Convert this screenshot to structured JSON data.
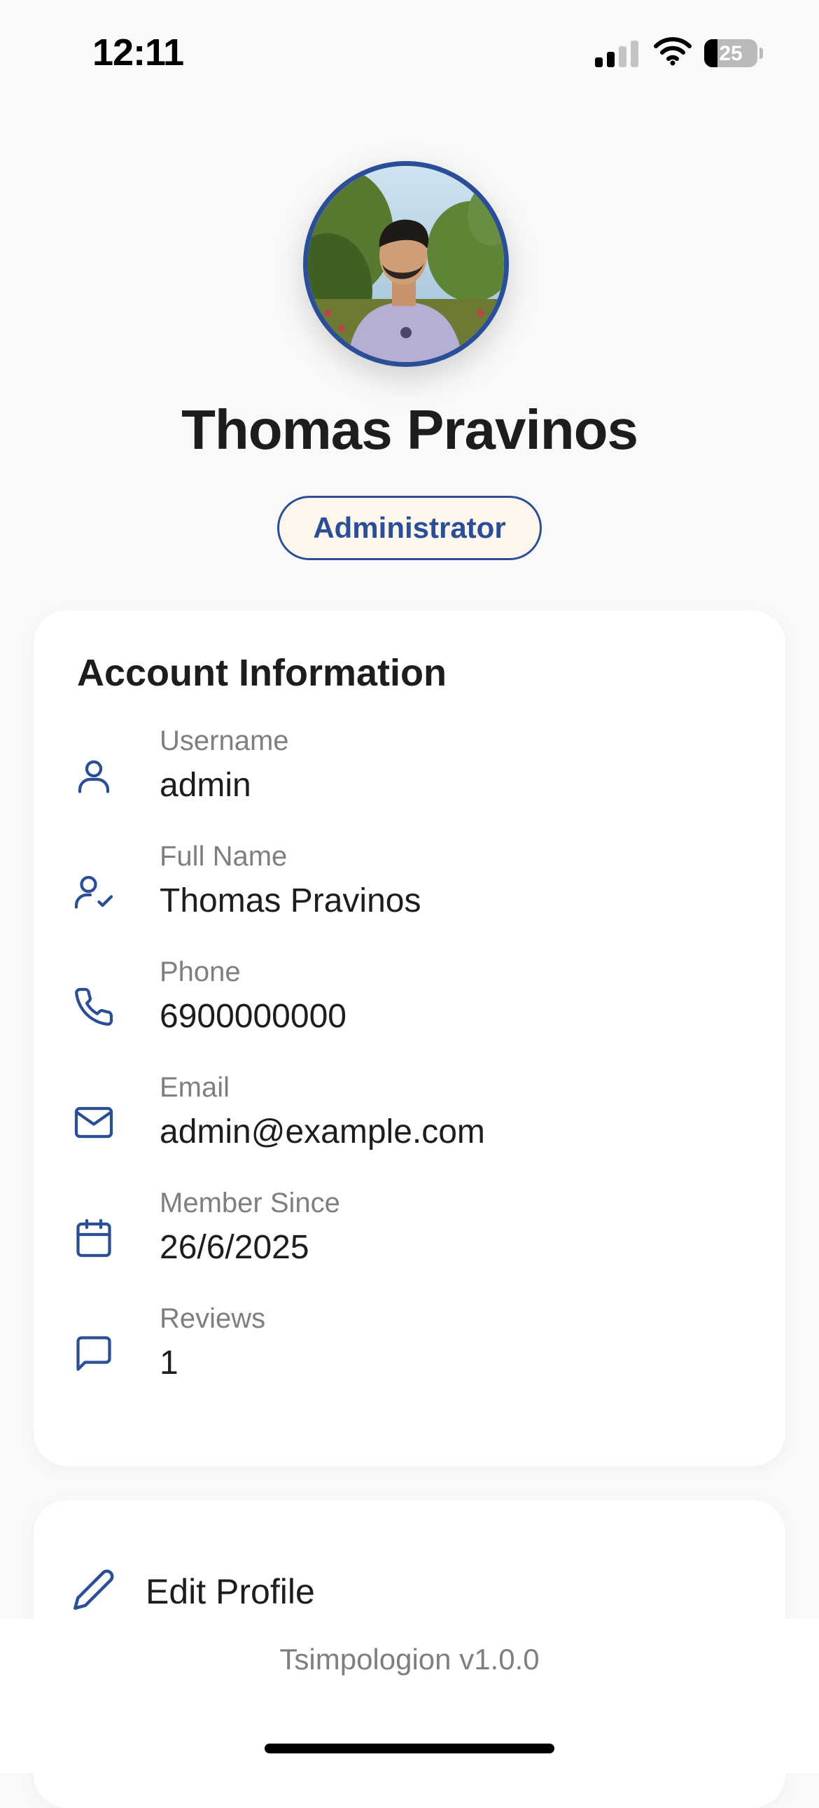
{
  "status_bar": {
    "time": "12:11",
    "battery_level": "25",
    "battery_fraction": 0.25
  },
  "profile": {
    "name": "Thomas Pravinos",
    "role": "Administrator"
  },
  "account_info": {
    "title": "Account Information",
    "rows": [
      {
        "icon": "user-icon",
        "label": "Username",
        "value": "admin"
      },
      {
        "icon": "user-check-icon",
        "label": "Full Name",
        "value": "Thomas Pravinos"
      },
      {
        "icon": "phone-icon",
        "label": "Phone",
        "value": "6900000000"
      },
      {
        "icon": "mail-icon",
        "label": "Email",
        "value": "admin@example.com"
      },
      {
        "icon": "calendar-icon",
        "label": "Member Since",
        "value": "26/6/2025"
      },
      {
        "icon": "message-square-icon",
        "label": "Reviews",
        "value": "1"
      }
    ]
  },
  "actions": {
    "edit_profile": "Edit Profile"
  },
  "footer": {
    "version": "Tsimpologion v1.0.0"
  },
  "colors": {
    "accent": "#2a4f97",
    "badge_background": "#fdf6ed",
    "label_gray": "#7e7e83"
  }
}
